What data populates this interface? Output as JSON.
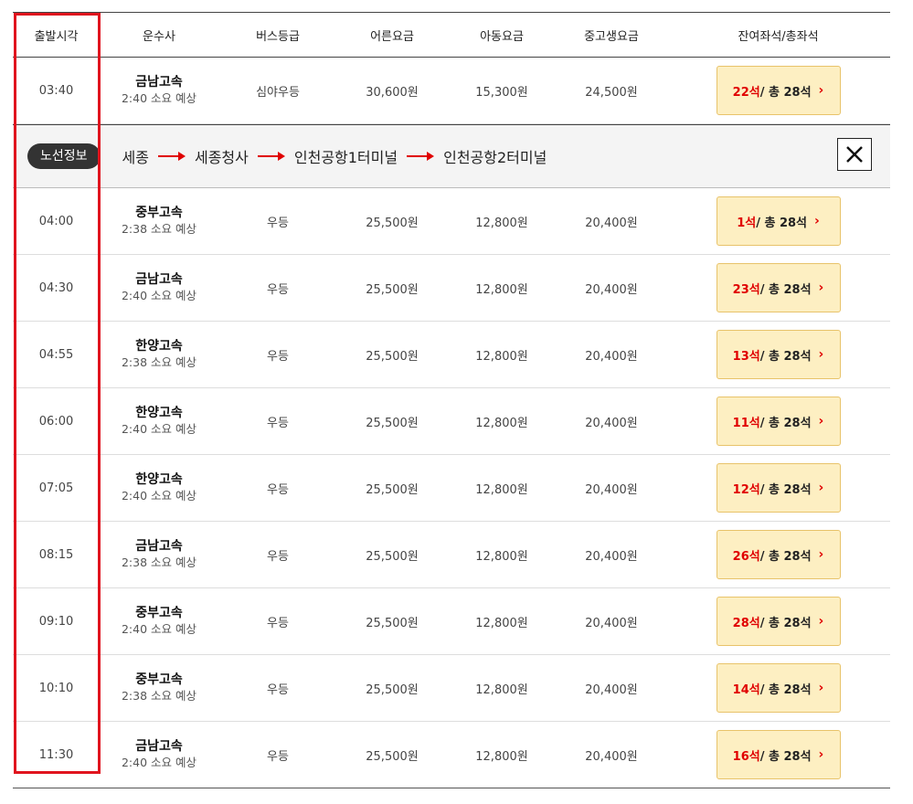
{
  "headers": {
    "time": "출발시각",
    "company": "운수사",
    "grade": "버스등급",
    "adult": "어른요금",
    "child": "아동요금",
    "youth": "중고생요금",
    "seats": "잔여좌석/총좌석"
  },
  "route": {
    "badge": "노선정보",
    "stops": [
      "세종",
      "세종청사",
      "인천공항1터미널",
      "인천공항2터미널"
    ]
  },
  "rows": [
    {
      "time": "03:40",
      "company": "금남고속",
      "duration": "2:40 소요 예상",
      "grade": "심야우등",
      "adult": "30,600원",
      "child": "15,300원",
      "youth": "24,500원",
      "remaining": "22석",
      "total": " / 총 28석"
    },
    {
      "time": "04:00",
      "company": "중부고속",
      "duration": "2:38 소요 예상",
      "grade": "우등",
      "adult": "25,500원",
      "child": "12,800원",
      "youth": "20,400원",
      "remaining": "1석",
      "total": " / 총 28석"
    },
    {
      "time": "04:30",
      "company": "금남고속",
      "duration": "2:40 소요 예상",
      "grade": "우등",
      "adult": "25,500원",
      "child": "12,800원",
      "youth": "20,400원",
      "remaining": "23석",
      "total": " / 총 28석"
    },
    {
      "time": "04:55",
      "company": "한양고속",
      "duration": "2:38 소요 예상",
      "grade": "우등",
      "adult": "25,500원",
      "child": "12,800원",
      "youth": "20,400원",
      "remaining": "13석",
      "total": " / 총 28석"
    },
    {
      "time": "06:00",
      "company": "한양고속",
      "duration": "2:40 소요 예상",
      "grade": "우등",
      "adult": "25,500원",
      "child": "12,800원",
      "youth": "20,400원",
      "remaining": "11석",
      "total": " / 총 28석"
    },
    {
      "time": "07:05",
      "company": "한양고속",
      "duration": "2:40 소요 예상",
      "grade": "우등",
      "adult": "25,500원",
      "child": "12,800원",
      "youth": "20,400원",
      "remaining": "12석",
      "total": " / 총 28석"
    },
    {
      "time": "08:15",
      "company": "금남고속",
      "duration": "2:38 소요 예상",
      "grade": "우등",
      "adult": "25,500원",
      "child": "12,800원",
      "youth": "20,400원",
      "remaining": "26석",
      "total": " / 총 28석"
    },
    {
      "time": "09:10",
      "company": "중부고속",
      "duration": "2:40 소요 예상",
      "grade": "우등",
      "adult": "25,500원",
      "child": "12,800원",
      "youth": "20,400원",
      "remaining": "28석",
      "total": " / 총 28석"
    },
    {
      "time": "10:10",
      "company": "중부고속",
      "duration": "2:38 소요 예상",
      "grade": "우등",
      "adult": "25,500원",
      "child": "12,800원",
      "youth": "20,400원",
      "remaining": "14석",
      "total": " / 총 28석"
    },
    {
      "time": "11:30",
      "company": "금남고속",
      "duration": "2:40 소요 예상",
      "grade": "우등",
      "adult": "25,500원",
      "child": "12,800원",
      "youth": "20,400원",
      "remaining": "16석",
      "total": " / 총 28석"
    }
  ],
  "icons": {
    "close": "close-icon",
    "chevron": "chevron-right-icon",
    "arrow": "arrow-right-icon"
  },
  "colors": {
    "accent": "#e00000",
    "seat_button_bg": "#fdefc2",
    "highlight": "#e0141e"
  }
}
